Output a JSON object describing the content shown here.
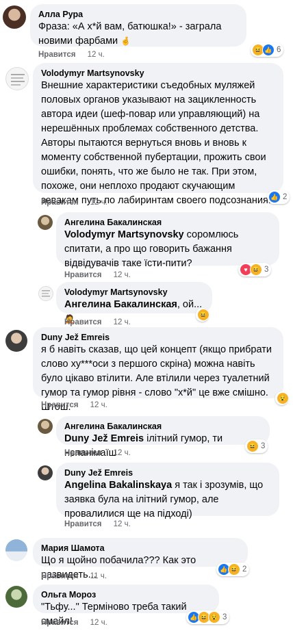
{
  "comments": [
    {
      "author": "Алла Рура",
      "text": "Фраза: «А х*й вам, батюшка!» - заграла новими фарбами",
      "emoji": "🤞",
      "like_label": "Нравится",
      "time": "12 ч.",
      "reaction_count": "6"
    },
    {
      "author": "Volodymyr Martsynovsky",
      "text": "Внешние характеристики съедобных муляжей половых органов указывают на зацикленность автора идеи (шеф-повар или управляющий) на нерешённых проблемах собственного детства. Авторы пытаются вернуться вновь и вновь к моменту собственной пубертации, прожить свои ошибки, понять, что же было не так. При этом, похоже, они неплохо продают скучающим зевакам путь по лабиринтам своего подсознания.",
      "like_label": "Нравится",
      "time": "12 ч.",
      "reaction_count": "2"
    },
    {
      "author": "Ангелина Бакалинская",
      "mention": "Volodymyr Martsynovsky",
      "text": " соромлюсь спитати, а про що говорить бажання відвідувачів таке їсти-пити?",
      "like_label": "Нравится",
      "time": "12 ч.",
      "reaction_count": "3"
    },
    {
      "author": "Volodymyr Martsynovsky",
      "mention": "Ангелина Бакалинская",
      "text": ", ой...",
      "emoji": "🤦",
      "like_label": "Нравится",
      "time": "12 ч."
    },
    {
      "author": "Duny Jež Emreis",
      "text": "я б навіть сказав, що цей концепт (якщо прибрати слово ху***оси з першого скріна) можна навіть було цікаво втілити. Але втілили через туалетний гумор та гумор рівня - слово \"х*й\" це вже смішно. Штош.",
      "like_label": "Нравится",
      "time": "12 ч."
    },
    {
      "author": "Ангелина Бакалинская",
      "mention": "Duny Jež Emreis",
      "text": " ілітний гумор, ти нєпанімаїш",
      "like_label": "Нравится",
      "time": "12 ч.",
      "reaction_count": "3"
    },
    {
      "author": "Duny Jež Emreis",
      "mention": "Angelina Bakalinskaya",
      "text": " я так і зрозумів, що заявка була на ілітний гумор, але провалилися ще на підході)",
      "like_label": "Нравится",
      "time": "12 ч."
    },
    {
      "author": "Мария Шамота",
      "text": "Що я щойно побачила??? Как это развидеть...",
      "like_label": "Нравится",
      "time": "11 ч.",
      "reaction_count": "2"
    },
    {
      "author": "Ольга Мороз",
      "text": "\"Тьфу...\" Терміново треба такий смайл!",
      "like_label": "Нравится",
      "time": "12 ч.",
      "reaction_count": "3"
    }
  ],
  "colors": {
    "bubble": "#f0f2f5",
    "meta": "#65676b",
    "haha": "#f7b125",
    "like": "#1877f2",
    "love": "#f33e58"
  }
}
